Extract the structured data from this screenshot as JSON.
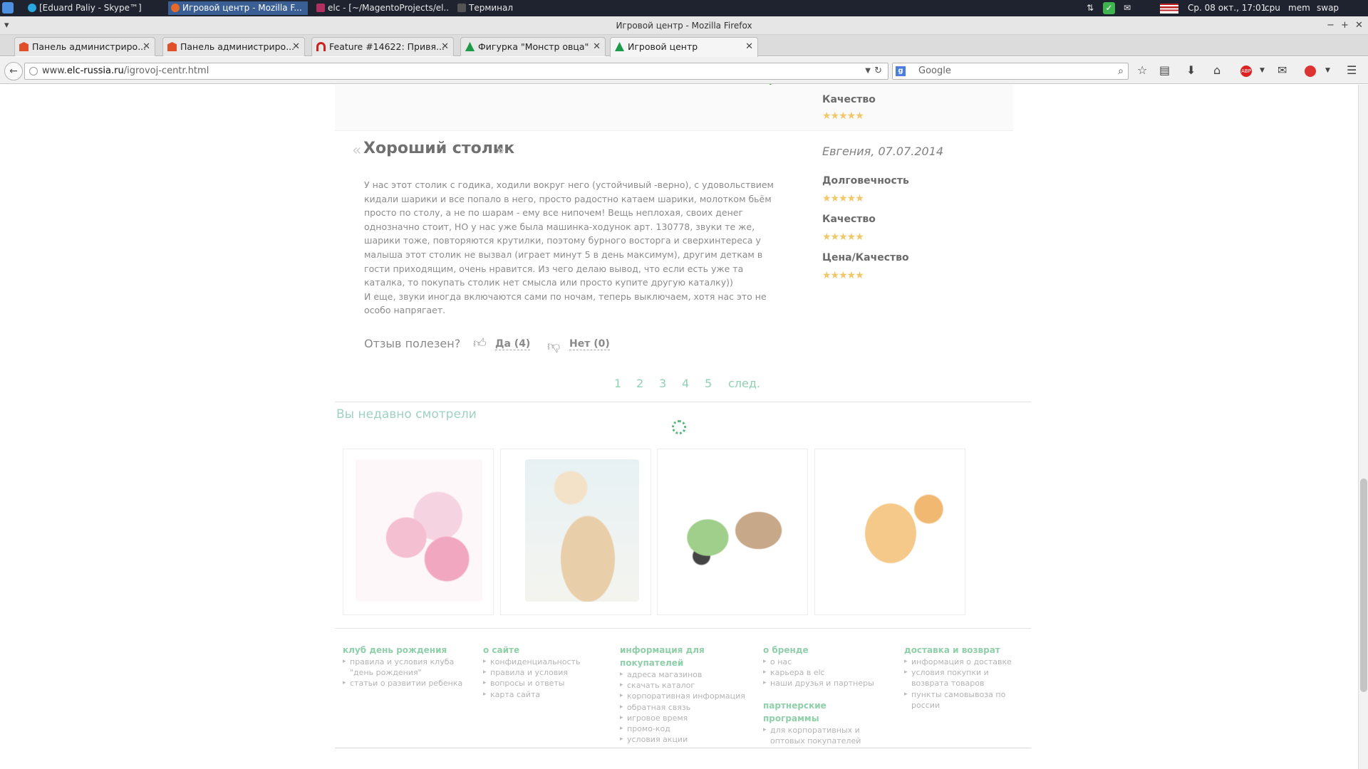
{
  "taskbar": {
    "tasks": [
      "[Eduard Paliy - Skype™]",
      "Игровой центр - Mozilla F...",
      "elc - [~/MagentoProjects/el...",
      "Терминал"
    ],
    "datetime": "Ср. 08 окт., 17:01",
    "cpu": "cpu",
    "mem": "mem",
    "swap": "swap"
  },
  "window": {
    "title": "Игровой центр - Mozilla Firefox"
  },
  "tabs": [
    "Панель администриро...",
    "Панель администриро...",
    "Feature #14622: Привя...",
    "Фигурка \"Монстр овца\"",
    "Игровой центр"
  ],
  "address": {
    "host_prefix": "www.",
    "host": "elc-russia.ru",
    "path": "/igrovoj-centr.html"
  },
  "search": {
    "placeholder": "Google"
  },
  "colors": {
    "accent_green": "#8fd1b0",
    "star": "#f0c86a"
  },
  "review_prev": {
    "quality_label": "Качество"
  },
  "review": {
    "title": "Хороший столик",
    "author_date": "Евгения, 07.07.2014",
    "text_1": "У нас этот столик с годика, ходили вокруг него (устойчивый -верно), с удовольствием кидали шарики и все попало в него, просто радостно катаем шарики, молотком бьём просто по столу, а не по шарам - ему все нипочем! Вещь неплохая, своих денег однозначно стоит, НО у нас уже была машинка-ходунок арт. 130778, звуки те же, шарики тоже, повторяются крутилки, поэтому бурного восторга и сверхинтереса у малыша этот столик не вызвал (играет минут 5 в день максимум), другим деткам в гости приходящим, очень нравится. Из чего делаю вывод, что если есть уже та каталка, то покупать столик нет смысла или просто купите другую каталку))",
    "text_2": "И еще, звуки иногда включаются сами по ночам, теперь выключаем, хотя нас это не особо напрягает.",
    "ratings": [
      {
        "label": "Долговечность",
        "stars": 5
      },
      {
        "label": "Качество",
        "stars": 5
      },
      {
        "label": "Цена/Качество",
        "stars": 5
      }
    ],
    "helpful_question": "Отзыв полезен?",
    "yes": "Да (4)",
    "no": "Нет (0)"
  },
  "pager": {
    "pages": [
      "1",
      "2",
      "3",
      "4",
      "5"
    ],
    "next": "след."
  },
  "recent": {
    "title": "Вы недавно смотрели"
  },
  "footer": {
    "col1": {
      "title": "клуб день рождения",
      "links": [
        "правила и условия клуба \"день рождения\"",
        "статьи о развитии ребенка"
      ]
    },
    "col2": {
      "title": "о сайте",
      "links": [
        "конфиденциальность",
        "правила и условия",
        "вопросы и ответы",
        "карта сайта"
      ]
    },
    "col3": {
      "title": "информация для покупателей",
      "links": [
        "адреса магазинов",
        "скачать каталог",
        "корпоративная информация",
        "обратная связь",
        "игровое время",
        "промо-код",
        "условия акции"
      ]
    },
    "col4": {
      "title": "о бренде",
      "links": [
        "о нас",
        "карьера в elc",
        "наши друзья и партнеры"
      ]
    },
    "col4b": {
      "title": "партнерские программы",
      "links": [
        "для корпоративных и оптовых покупателей"
      ]
    },
    "col5": {
      "title": "доставка и возврат",
      "links": [
        "информация о доставке",
        "условия покупки и возврата товаров",
        "пункты самовывоза по россии"
      ]
    }
  }
}
